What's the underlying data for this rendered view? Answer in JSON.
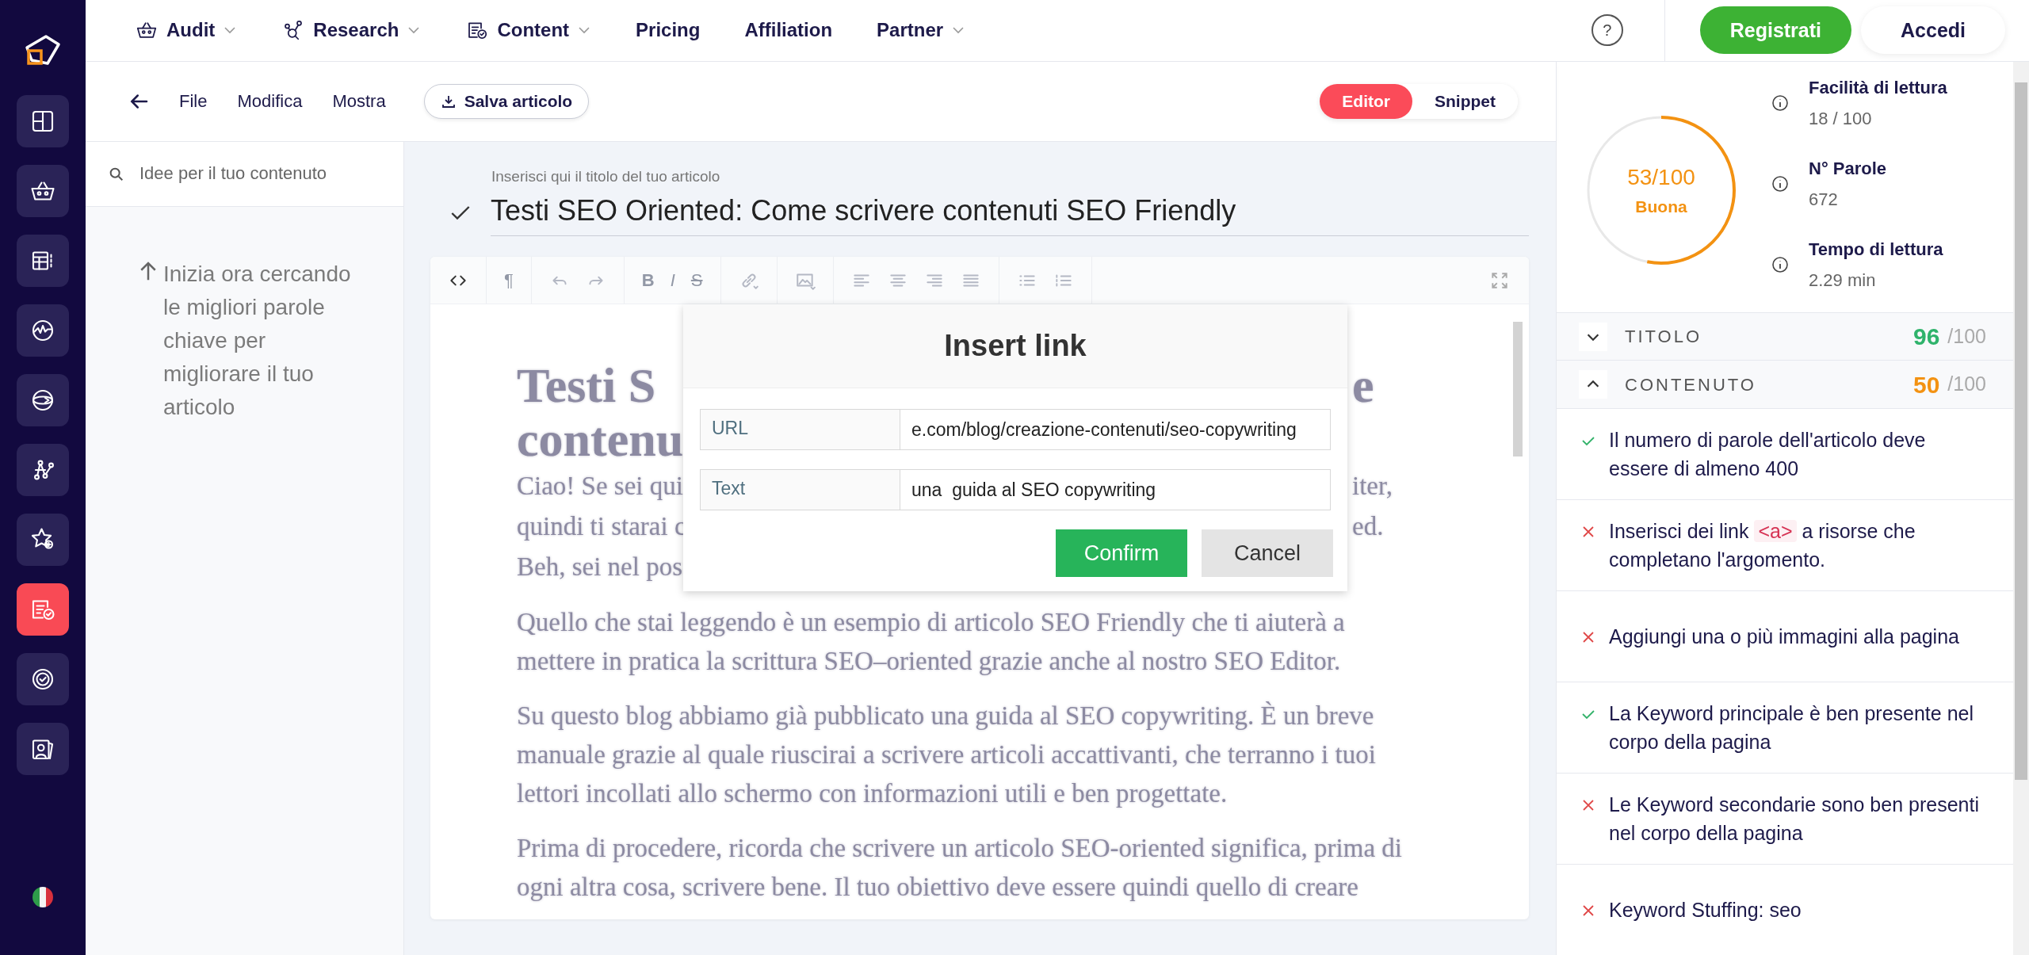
{
  "top_nav": {
    "items": [
      {
        "label": "Audit",
        "dropdown": true
      },
      {
        "label": "Research",
        "dropdown": true
      },
      {
        "label": "Content",
        "dropdown": true
      },
      {
        "label": "Pricing",
        "dropdown": false
      },
      {
        "label": "Affiliation",
        "dropdown": false
      },
      {
        "label": "Partner",
        "dropdown": true
      }
    ],
    "help": "?",
    "register": "Registrati",
    "login": "Accedi"
  },
  "sidebar": {
    "items": [
      {
        "selected": false
      },
      {
        "selected": false
      },
      {
        "selected": false
      },
      {
        "selected": false
      },
      {
        "selected": false
      },
      {
        "selected": false
      },
      {
        "selected": false
      },
      {
        "selected": true
      },
      {
        "selected": false
      },
      {
        "selected": false
      }
    ]
  },
  "editor_bar": {
    "menu": [
      "File",
      "Modifica",
      "Mostra"
    ],
    "save": "Salva articolo",
    "tabs": [
      {
        "label": "Editor",
        "selected": true
      },
      {
        "label": "Snippet",
        "selected": false
      }
    ]
  },
  "ideas": {
    "placeholder": "Idee per il tuo contenuto",
    "hint": "Inizia ora cercando le migliori parole chiave per migliorare il tuo articolo"
  },
  "title": {
    "label": "Inserisci qui il titolo del tuo articolo",
    "value": "Testi SEO Oriented: Come scrivere contenuti SEO Friendly",
    "confirmed": true
  },
  "toolbar": {
    "groups": [
      [
        {
          "kind": "code",
          "disabled": false
        }
      ],
      [
        {
          "kind": "paragraph",
          "label": "¶",
          "disabled": true
        }
      ],
      [
        {
          "kind": "undo",
          "disabled": true
        },
        {
          "kind": "redo",
          "disabled": true
        }
      ],
      [
        {
          "kind": "bold",
          "label": "B",
          "disabled": true
        },
        {
          "kind": "italic",
          "label": "I",
          "disabled": true
        },
        {
          "kind": "strike",
          "label": "S",
          "disabled": true
        }
      ],
      [
        {
          "kind": "link",
          "disabled": true
        }
      ],
      [
        {
          "kind": "image",
          "disabled": true
        }
      ],
      [
        {
          "kind": "align-left",
          "disabled": true
        },
        {
          "kind": "align-center",
          "disabled": true
        },
        {
          "kind": "align-right",
          "disabled": true
        },
        {
          "kind": "justify",
          "disabled": true
        }
      ],
      [
        {
          "kind": "bullet-list",
          "disabled": true
        },
        {
          "kind": "number-list",
          "disabled": true
        }
      ]
    ]
  },
  "document": {
    "covered_lines": [
      {
        "kind": "heading",
        "left": "Testi S",
        "right": "e"
      },
      {
        "kind": "heading",
        "left": "contenu"
      },
      {
        "kind": "text",
        "left": "Ciao! Se sei qui",
        "right": "iter,"
      },
      {
        "kind": "text",
        "left": "quindi ti starai c",
        "right": "ed."
      },
      {
        "kind": "text",
        "left": "Beh, sei nel pos"
      }
    ],
    "paragraphs": [
      "Quello che stai leggendo è un esempio di articolo SEO Friendly che ti aiuterà a mettere in pratica la scrittura SEO–oriented grazie anche al nostro SEO Editor.",
      "Su questo blog abbiamo già pubblicato una guida al SEO copywriting. È un breve manuale grazie al quale riuscirai a scrivere articoli accattivanti, che terranno i tuoi lettori incollati allo schermo con informazioni utili e ben progettate.",
      "Prima di procedere, ricorda che scrivere un articolo SEO-oriented significa, prima di ogni altra cosa, scrivere bene. Il tuo obiettivo deve essere quindi quello di creare"
    ]
  },
  "dialog": {
    "title": "Insert link",
    "fields": [
      {
        "label": "URL",
        "value": "e.com/blog/creazione-contenuti/seo-copywriting"
      },
      {
        "label": "Text",
        "value": "una  guida al SEO copywriting"
      }
    ],
    "confirm": "Confirm",
    "cancel": "Cancel"
  },
  "score": {
    "value": "53/100",
    "rating": "Buona",
    "level": 0.53,
    "metrics": [
      {
        "label": "Facilità di lettura",
        "value": "18 / 100"
      },
      {
        "label": "N° Parole",
        "value": "672"
      },
      {
        "label": "Tempo di lettura",
        "value": "2.29 min"
      }
    ]
  },
  "sections": [
    {
      "name": "TITOLO",
      "score": "96",
      "max": "/100",
      "expanded": false,
      "color": "#2fb36b"
    },
    {
      "name": "CONTENUTO",
      "score": "50",
      "max": "/100",
      "expanded": true,
      "color": "#f39212",
      "checks": [
        {
          "passed": true,
          "text": "Il numero di parole dell'articolo deve essere di almeno 400"
        },
        {
          "passed": false,
          "text": "Inserisci dei link",
          "code": "<a>",
          "text_after": "a risorse che completano l'argomento."
        },
        {
          "passed": false,
          "text": "Aggiungi una o più immagini alla pagina"
        },
        {
          "passed": true,
          "text": "La Keyword principale è ben presente nel corpo della pagina"
        },
        {
          "passed": false,
          "text": "Le Keyword secondarie sono ben presenti nel corpo della pagina"
        },
        {
          "passed": false,
          "text": "Keyword Stuffing: seo"
        }
      ]
    }
  ]
}
